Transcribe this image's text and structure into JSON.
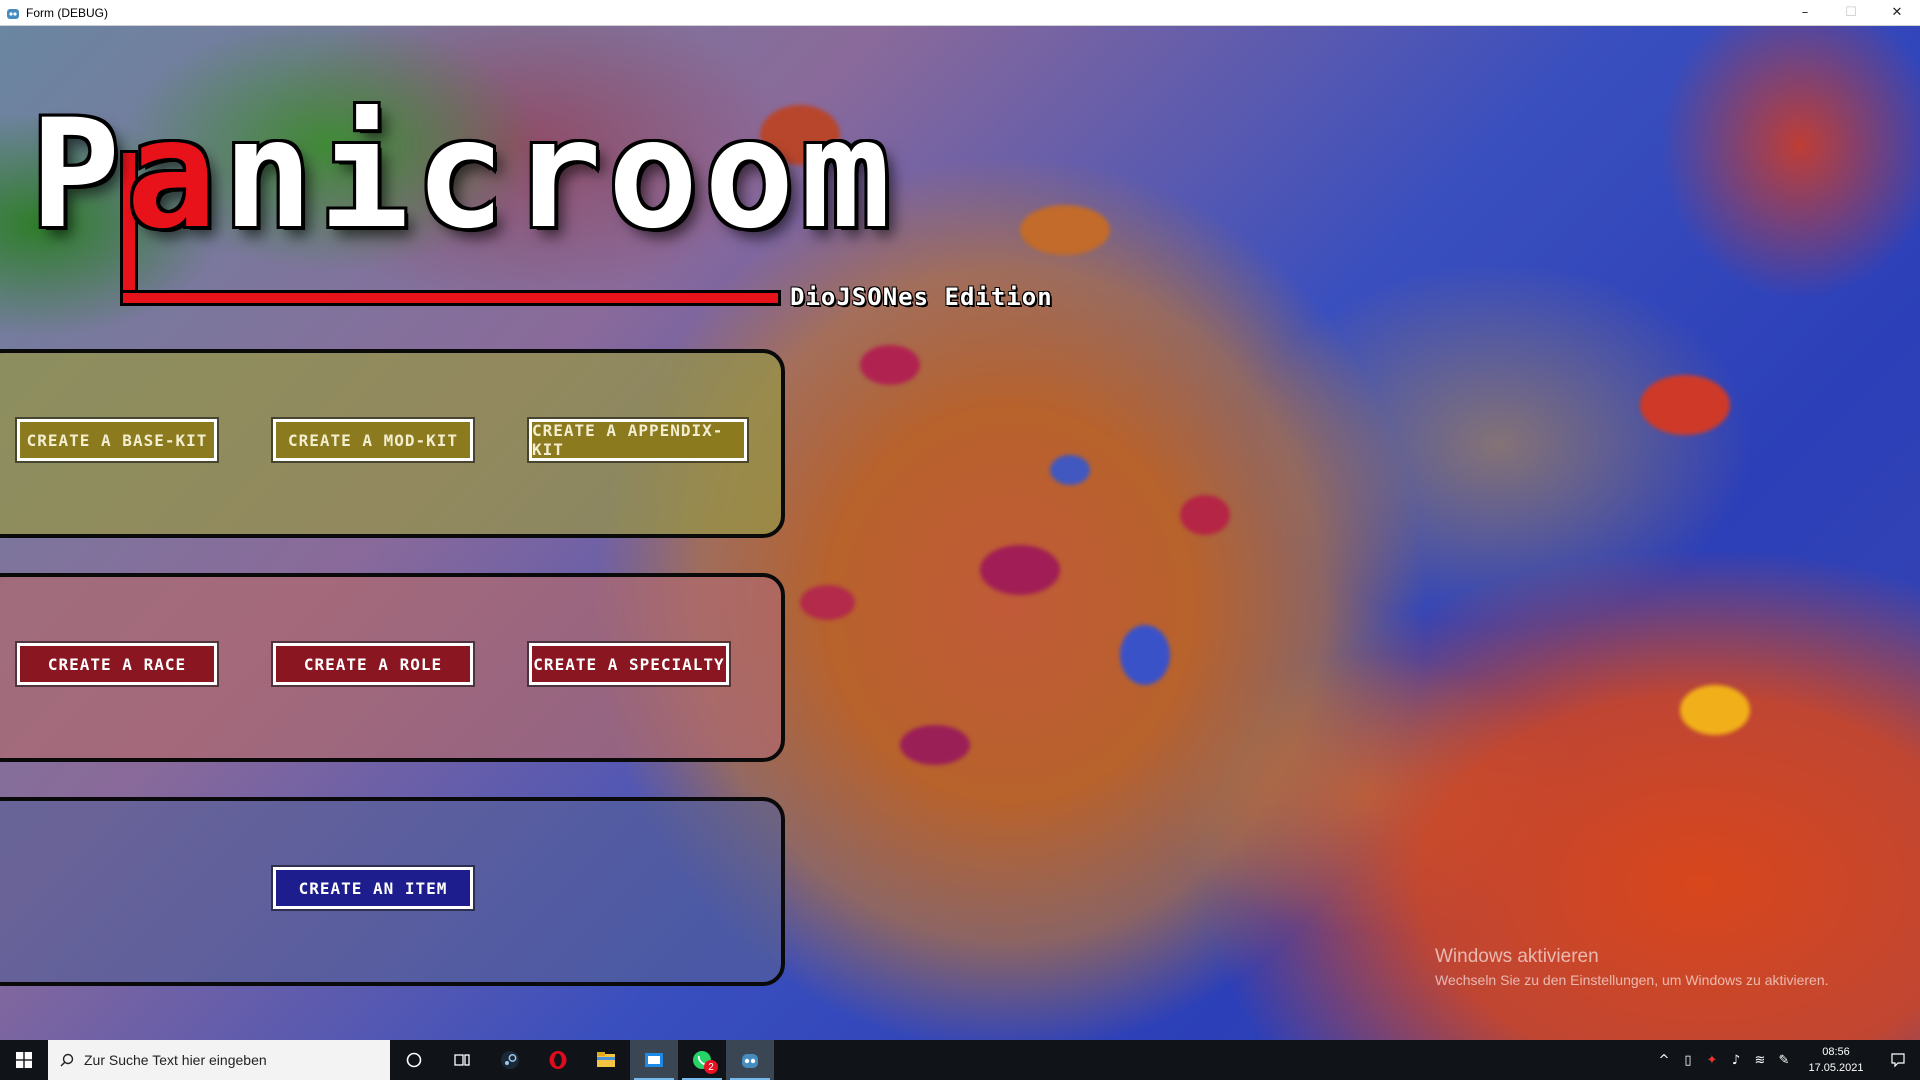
{
  "window": {
    "title": "Form (DEBUG)",
    "controls": {
      "minimize": "–",
      "maximize": "☐",
      "close": "✕"
    }
  },
  "logo": {
    "first_letter": "P",
    "red_letter": "a",
    "rest": "nicroom",
    "edition": "DioJSONes Edition",
    "colors": {
      "accent": "#e8121b",
      "text": "#ffffff",
      "outline": "#000000"
    }
  },
  "buttons": {
    "base_kit": "CREATE A BASE-KIT",
    "mod_kit": "CREATE A MOD-KIT",
    "appendix_kit": "CREATE A APPENDIX-KIT",
    "race": "CREATE A RACE",
    "role": "CREATE A ROLE",
    "specialty": "CREATE A SPECIALTY",
    "item": "CREATE AN ITEM"
  },
  "button_colors": {
    "olive": "#8b7a1e",
    "red": "#8a1622",
    "navy": "#1d1d8e"
  },
  "watermark": {
    "title": "Windows aktivieren",
    "subtitle": "Wechseln Sie zu den Einstellungen, um Windows zu aktivieren."
  },
  "taskbar": {
    "search_placeholder": "Zur Suche Text hier eingeben",
    "apps": [
      "cortana-icon",
      "task-view-icon",
      "steam-icon",
      "opera-icon",
      "file-explorer-icon",
      "app-window-icon",
      "whatsapp-icon",
      "godot-icon"
    ],
    "whatsapp_badge": "2",
    "time": "08:56",
    "date": "17.05.2021"
  }
}
